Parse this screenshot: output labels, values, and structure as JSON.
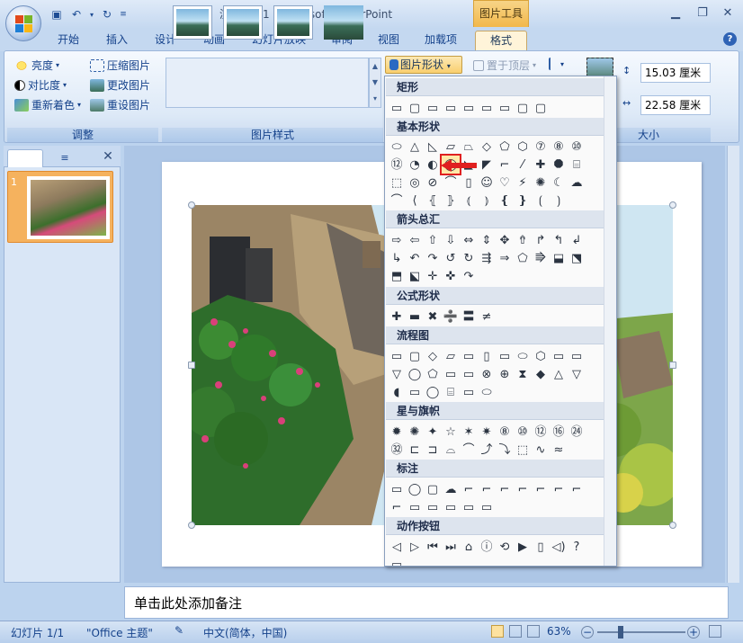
{
  "window": {
    "title": "演示文稿1 - Microsoft PowerPoint",
    "tools_title": "图片工具"
  },
  "tabs": [
    {
      "label": "开始"
    },
    {
      "label": "插入"
    },
    {
      "label": "设计"
    },
    {
      "label": "动画"
    },
    {
      "label": "幻灯片放映"
    },
    {
      "label": "审阅"
    },
    {
      "label": "视图"
    },
    {
      "label": "加载项"
    },
    {
      "label": "格式"
    }
  ],
  "ribbon": {
    "adjust": {
      "brightness": "亮度",
      "contrast": "对比度",
      "recolor": "重新着色",
      "compress": "压缩图片",
      "change": "更改图片",
      "reset": "重设图片",
      "group_label": "调整"
    },
    "styles": {
      "group_label": "图片样式"
    },
    "shape_button": "图片形状",
    "bring_front": "置于顶层",
    "size": {
      "height": "15.03 厘米",
      "width": "22.58 厘米",
      "group_label": "大小"
    }
  },
  "dropdown": {
    "categories": [
      {
        "name": "矩形",
        "shapes": [
          "▭",
          "▢",
          "▭",
          "▭",
          "▭",
          "▭",
          "▭",
          "▢",
          "▢"
        ]
      },
      {
        "name": "基本形状",
        "shapes": [
          "⬭",
          "△",
          "◺",
          "▱",
          "⏢",
          "◇",
          "⬠",
          "⬡",
          "⑦",
          "⑧",
          "⑩",
          "⑫",
          "◔",
          "◐",
          "◯",
          "◣",
          "◤",
          "⌐",
          "⁄",
          "✚",
          "⯃",
          "⌸",
          "⬚",
          "◎",
          "⊘",
          "⌒",
          "▯",
          "☺",
          "♡",
          "⚡",
          "✺",
          "☾",
          "☁",
          "⌒",
          "⟨",
          "⦃",
          "⦄",
          "⦅",
          "⦆",
          "❴",
          "❵",
          "⟮",
          "⟯"
        ]
      },
      {
        "name": "箭头总汇",
        "shapes": [
          "⇨",
          "⇦",
          "⇧",
          "⇩",
          "⇔",
          "⇕",
          "✥",
          "⇮",
          "↱",
          "↰",
          "↲",
          "↳",
          "↶",
          "↷",
          "↺",
          "↻",
          "⇶",
          "⇒",
          "⬠",
          "⭆",
          "⬓",
          "⬔",
          "⬒",
          "⬕",
          "✛",
          "✜",
          "↷"
        ]
      },
      {
        "name": "公式形状",
        "shapes": [
          "✚",
          "▬",
          "✖",
          "➗",
          "〓",
          "≠"
        ]
      },
      {
        "name": "流程图",
        "shapes": [
          "▭",
          "▢",
          "◇",
          "▱",
          "▭",
          "▯",
          "▭",
          "⬭",
          "⬡",
          "▭",
          "▭",
          "▽",
          "◯",
          "⬠",
          "▭",
          "▭",
          "⊗",
          "⊕",
          "⧗",
          "◆",
          "△",
          "▽",
          "◖",
          "▭",
          "◯",
          "⌸",
          "▭",
          "⬭"
        ]
      },
      {
        "name": "星与旗帜",
        "shapes": [
          "✹",
          "✺",
          "✦",
          "☆",
          "✶",
          "✷",
          "⑧",
          "⑩",
          "⑫",
          "⑯",
          "㉔",
          "㉜",
          "⊏",
          "⊐",
          "⌓",
          "⌒",
          "⤴",
          "⤵",
          "⬚",
          "∿",
          "≈"
        ]
      },
      {
        "name": "标注",
        "shapes": [
          "▭",
          "◯",
          "▢",
          "☁",
          "⌐",
          "⌐",
          "⌐",
          "⌐",
          "⌐",
          "⌐",
          "⌐",
          "⌐",
          "▭",
          "▭",
          "▭",
          "▭",
          "▭"
        ]
      },
      {
        "name": "动作按钮",
        "shapes": [
          "◁",
          "▷",
          "⏮",
          "⏭",
          "⌂",
          "ⓘ",
          "⟲",
          "▶",
          "▯",
          "◁)",
          "?",
          "▭"
        ]
      }
    ]
  },
  "pane": {
    "slide_number": "1"
  },
  "notes_placeholder": "单击此处添加备注",
  "status": {
    "slide": "幻灯片 1/1",
    "theme": "\"Office 主题\"",
    "language": "中文(简体，中国)",
    "zoom": "63%"
  },
  "colors": {
    "accent": "#f5b25e",
    "ribbon_bg": "#dde9f7",
    "selection": "#e02020"
  }
}
